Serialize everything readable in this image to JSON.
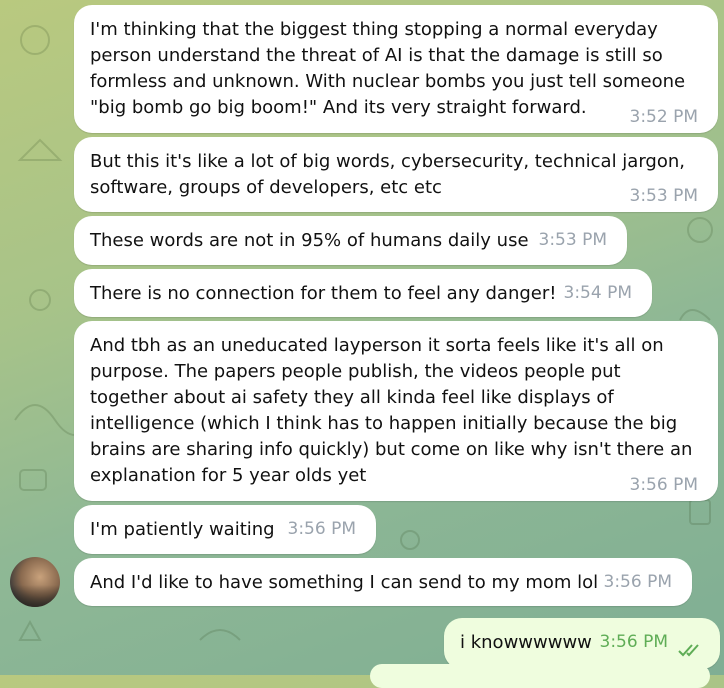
{
  "messages": [
    {
      "text": "I'm thinking that the biggest thing stopping a normal everyday\nperson understand the threat of AI is that the damage is still so\nformless and unknown. With nuclear bombs you just tell someone\n\"big bomb go big boom!\" And its very straight forward.",
      "time": "3:52 PM"
    },
    {
      "text": "But this it's like a lot of big words, cybersecurity, technical jargon,\nsoftware, groups of developers, etc etc",
      "time": "3:53 PM"
    },
    {
      "text": "These words are not in 95% of humans daily use",
      "time": "3:53 PM"
    },
    {
      "text": "There is no connection for them to feel any danger!",
      "time": "3:54 PM"
    },
    {
      "text": "And tbh as an uneducated layperson it sorta feels like it's all on\npurpose. The papers people publish, the videos people put\ntogether about ai safety they all kinda feel like displays of\nintelligence (which I think has to happen initially because the big\nbrains are sharing info quickly) but come on like why isn't there an\nexplanation for 5 year olds yet",
      "time": "3:56 PM"
    },
    {
      "text": "I'm patiently waiting",
      "time": "3:56 PM"
    },
    {
      "text": "And I'd like to have something I can send to my mom lol",
      "time": "3:56 PM"
    }
  ],
  "outgoing": {
    "text": "i knowwwwww",
    "time": "3:56 PM",
    "status_icon": "double-check-icon"
  },
  "colors": {
    "incoming_bubble": "#ffffff",
    "outgoing_bubble": "#effdde",
    "outgoing_time": "#5fad56",
    "incoming_time": "#9aa3ad"
  }
}
